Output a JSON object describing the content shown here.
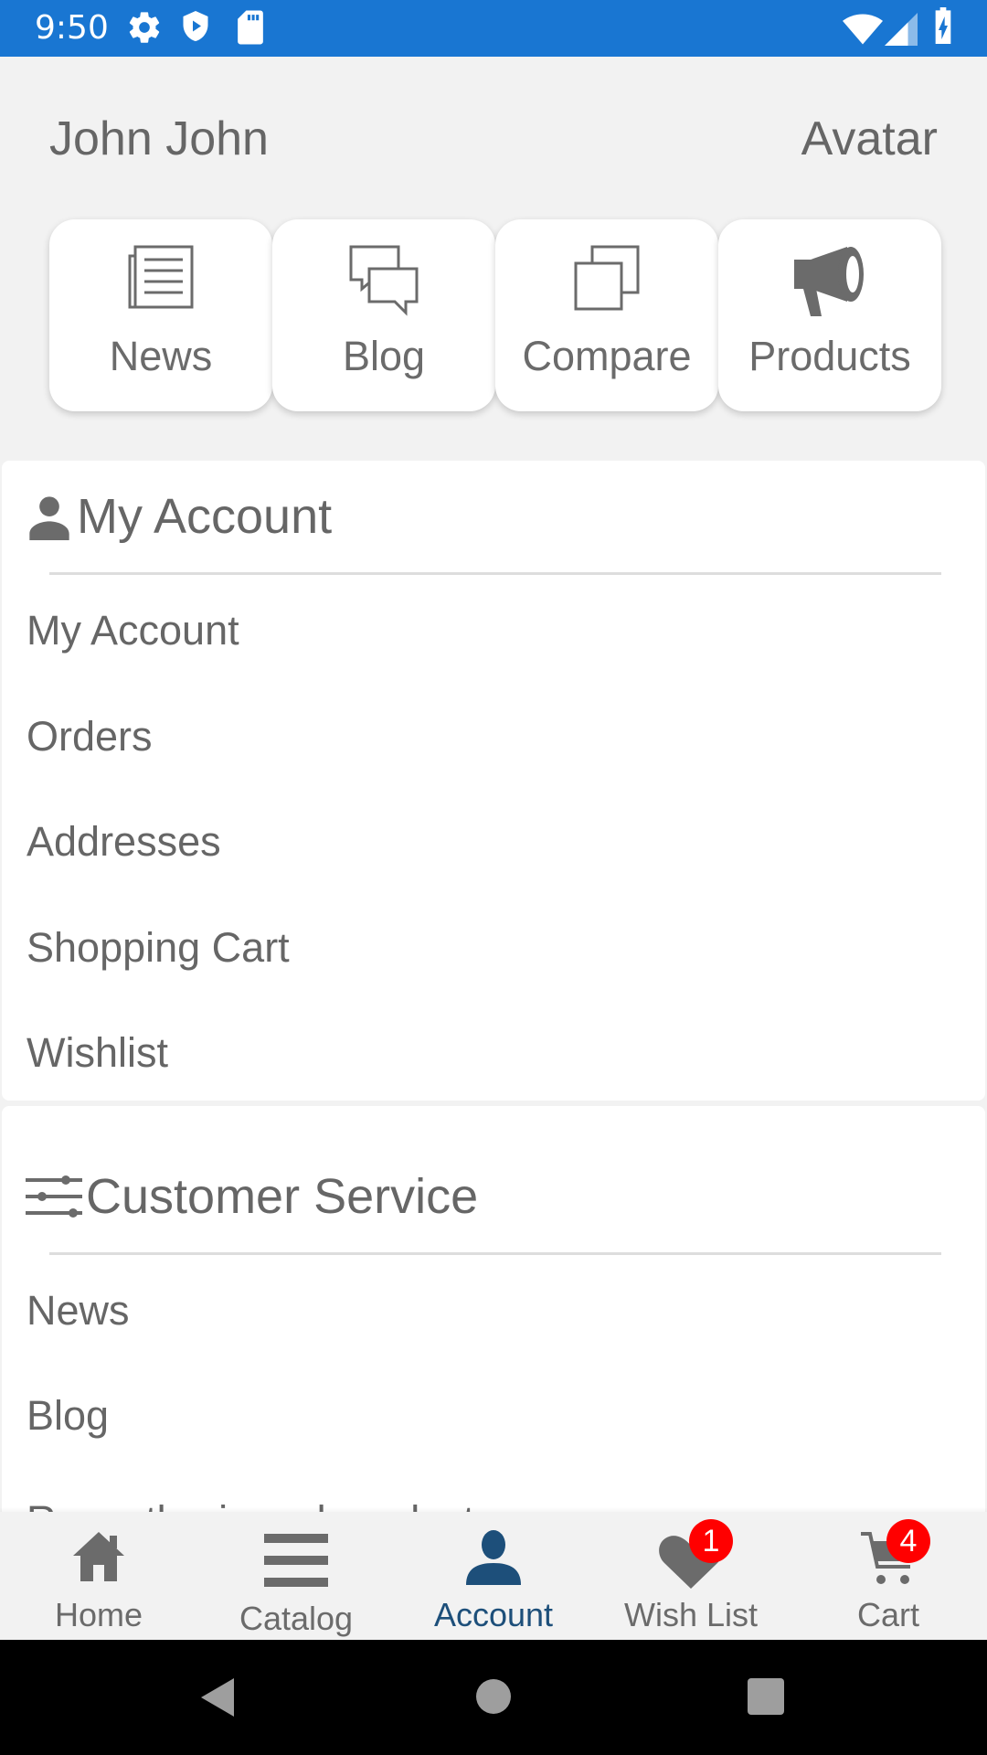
{
  "status_bar": {
    "time": "9:50",
    "left_icons": [
      "gear-icon",
      "shield-icon",
      "sd-card-icon"
    ],
    "right_icons": [
      "wifi-icon",
      "signal-icon",
      "battery-charging-icon"
    ],
    "color": "#1976d2"
  },
  "header": {
    "user_name": "John John",
    "avatar_label": "Avatar"
  },
  "quick_links": [
    {
      "label": "News",
      "icon": "newspaper-icon"
    },
    {
      "label": "Blog",
      "icon": "chat-bubbles-icon"
    },
    {
      "label": "Compare",
      "icon": "compare-icon"
    },
    {
      "label": "Products",
      "icon": "megaphone-icon"
    }
  ],
  "my_account": {
    "title": "My Account",
    "icon": "person-icon",
    "items": [
      "My Account",
      "Orders",
      "Addresses",
      "Shopping Cart",
      "Wishlist"
    ]
  },
  "customer_service": {
    "title": "Customer Service",
    "icon": "sliders-icon",
    "items": [
      "News",
      "Blog",
      "Recently viewed products"
    ]
  },
  "bottom_nav": {
    "items": [
      {
        "label": "Home",
        "icon": "home-icon",
        "active": false
      },
      {
        "label": "Catalog",
        "icon": "menu-icon",
        "active": false
      },
      {
        "label": "Account",
        "icon": "person-icon",
        "active": true
      },
      {
        "label": "Wish List",
        "icon": "heart-icon",
        "active": false,
        "badge": "1"
      },
      {
        "label": "Cart",
        "icon": "cart-icon",
        "active": false,
        "badge": "4"
      }
    ],
    "active_color": "#1d4f7a",
    "badge_color": "#ff0000"
  },
  "system_nav": {
    "buttons": [
      "back-icon",
      "home-circle-icon",
      "recents-icon"
    ]
  }
}
